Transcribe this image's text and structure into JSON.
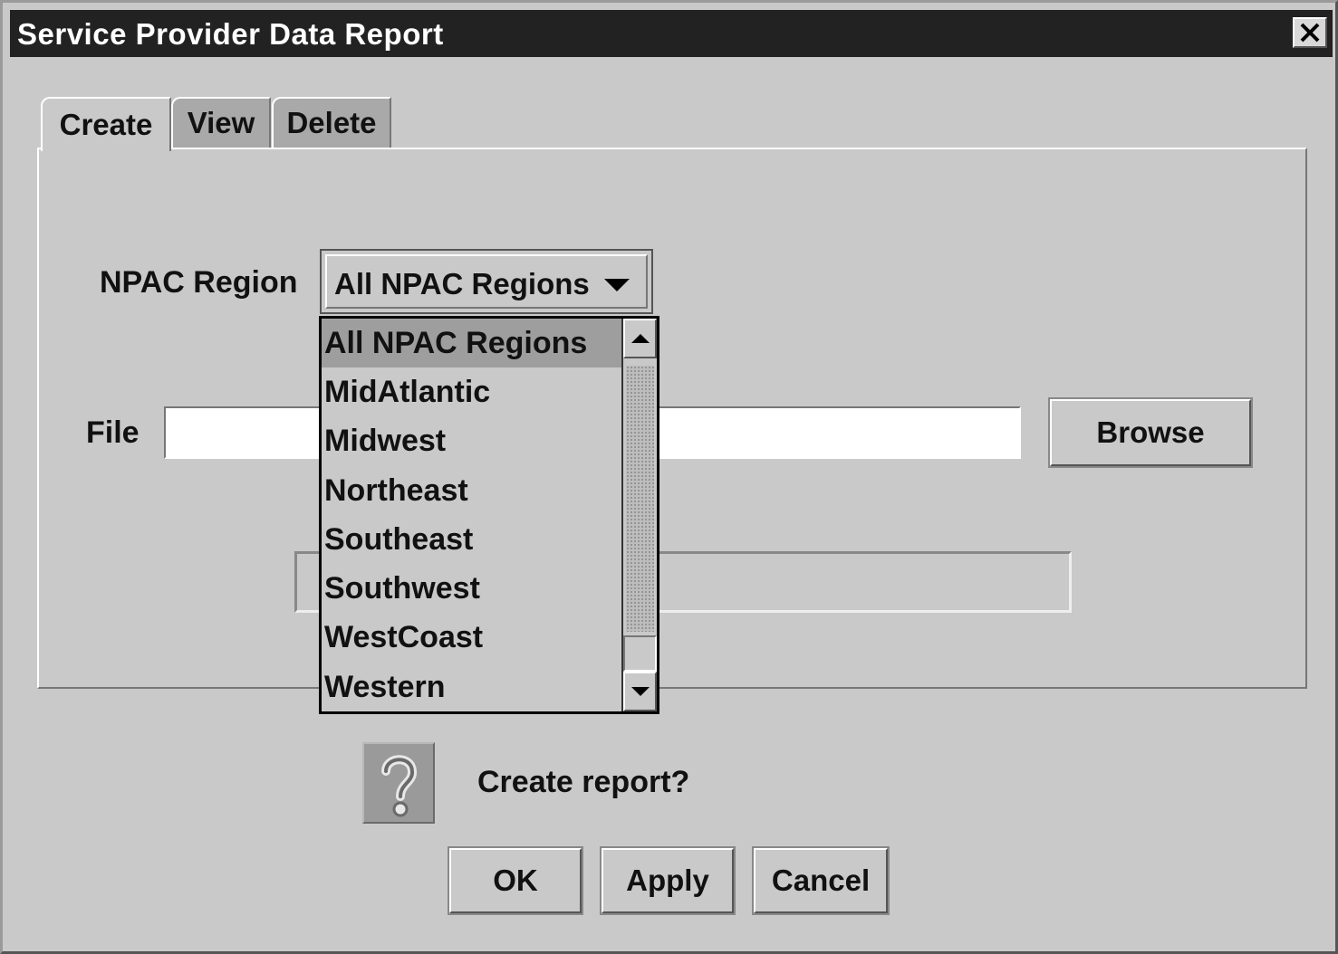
{
  "window": {
    "title": "Service Provider Data Report"
  },
  "tabs": [
    {
      "label": "Create",
      "active": true
    },
    {
      "label": "View",
      "active": false
    },
    {
      "label": "Delete",
      "active": false
    }
  ],
  "form": {
    "npac_label": "NPAC Region",
    "npac_selected": "All NPAC Regions",
    "file_label": "File",
    "file_value": "",
    "browse_label": "Browse"
  },
  "dropdown": {
    "options": [
      "All NPAC Regions",
      "MidAtlantic",
      "Midwest",
      "Northeast",
      "Southeast",
      "Southwest",
      "WestCoast",
      "Western"
    ],
    "highlighted_index": 0
  },
  "confirm": {
    "message": "Create report?",
    "icon": "question-icon"
  },
  "buttons": {
    "ok": "OK",
    "apply": "Apply",
    "cancel": "Cancel"
  },
  "colors": {
    "background": "#c9c9c9",
    "titlebar": "#222222",
    "selection": "#9e9e9e"
  }
}
